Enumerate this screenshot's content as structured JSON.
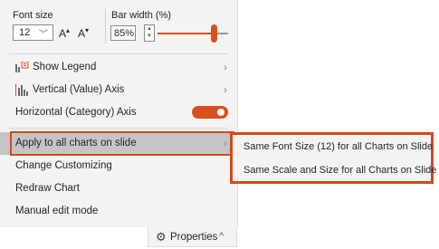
{
  "toolbar": {
    "font_size_label": "Font size",
    "font_size_value": "12",
    "grow_font": "A",
    "shrink_font": "A",
    "bar_width_label": "Bar width (%)",
    "bar_width_value": "85%",
    "bar_width_level": 0.8
  },
  "menu": {
    "items": [
      {
        "label": "Show Legend",
        "icon": "legend-icon",
        "has_submenu": true
      },
      {
        "label": "Vertical (Value) Axis",
        "icon": "bar-axis-icon",
        "has_submenu": true
      },
      {
        "label": "Horizontal (Category) Axis",
        "toggle_on": true
      },
      {
        "label": "Apply to all charts on slide",
        "has_submenu": true,
        "highlighted": true
      },
      {
        "label": "Change Customizing"
      },
      {
        "label": "Redraw Chart"
      },
      {
        "label": "Manual edit mode"
      }
    ],
    "arrow_glyph": "›"
  },
  "submenu": {
    "items": [
      {
        "label": "Same Font Size (12) for all Charts on Slide"
      },
      {
        "label": "Same Scale and Size for all Charts on Slide"
      }
    ]
  },
  "footer": {
    "properties_label": "Properties",
    "caret": "^"
  },
  "colors": {
    "accent": "#d9501e",
    "menu_bg": "#f3f3f3",
    "highlight_bg": "#c5c5c5"
  }
}
